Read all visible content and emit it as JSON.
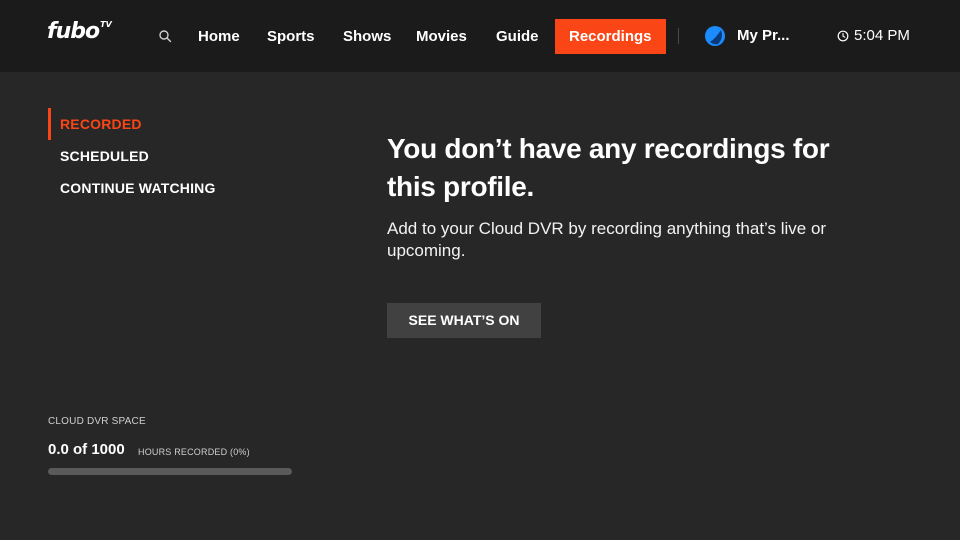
{
  "brand": {
    "logo_text": "fubo",
    "logo_tv": "TV",
    "accent": "#fa4616"
  },
  "nav": {
    "items": [
      {
        "label": "Home"
      },
      {
        "label": "Sports"
      },
      {
        "label": "Shows"
      },
      {
        "label": "Movies"
      },
      {
        "label": "Guide"
      },
      {
        "label": "Recordings",
        "active": true
      }
    ],
    "profile_label": "My Pr...",
    "time": "5:04 PM"
  },
  "sidebar": {
    "items": [
      {
        "label": "RECORDED",
        "active": true
      },
      {
        "label": "SCHEDULED"
      },
      {
        "label": "CONTINUE WATCHING"
      }
    ]
  },
  "empty_state": {
    "title": "You don’t have any recordings for this profile.",
    "subtitle": "Add to your Cloud DVR by recording anything that’s live or upcoming.",
    "cta_label": "SEE WHAT’S ON"
  },
  "dvr": {
    "label": "CLOUD DVR SPACE",
    "value": "0.0 of 1000",
    "unit_text": "HOURS RECORDED (0%)",
    "used_fraction": 0.0
  }
}
